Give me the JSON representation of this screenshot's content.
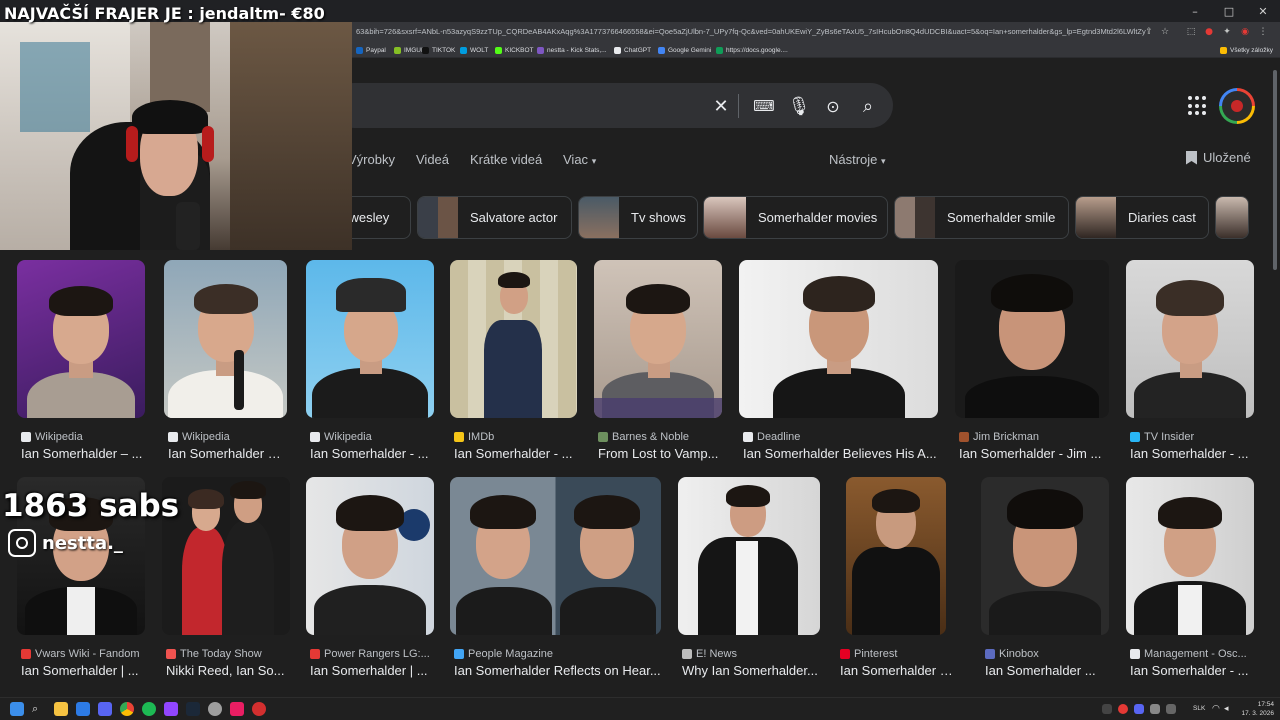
{
  "stream": {
    "title": "NAJVAČŠÍ FRAJER JE : jendaltm- €80",
    "subs": "1863 sabs",
    "instagram": "nestta._"
  },
  "browser": {
    "url": "63&bih=726&sxsrf=ANbL-n53azyqS9zzTUp_CQRDeAB4AKxAqg%3A1773766466558&ei=Qoe5aZjUlbn-7_UPy7fq-Qc&ved=0ahUKEwiY_ZyBs6eTAxU5_7sIHcubOn8Q4dUDCBI&uact=5&oq=Ian+somerhalder&gs_lp=Egtnd3Mtd2l6LWltZyIPSWFuIHNvbW",
    "all_bookmarks": "Všetky záložky",
    "bookmarks": [
      {
        "label": "Paypal",
        "color": "#1565c0"
      },
      {
        "label": "IMGUR",
        "color": "#85bf25"
      },
      {
        "label": "TIKTOK",
        "color": "#111111"
      },
      {
        "label": "WOLT",
        "color": "#009de0"
      },
      {
        "label": "KICKBOT",
        "color": "#53fc18"
      },
      {
        "label": "nestta - Kick Stats,...",
        "color": "#7e57c2"
      },
      {
        "label": "ChatGPT",
        "color": "#e8eaed"
      },
      {
        "label": "Google Gemini",
        "color": "#4285f4"
      },
      {
        "label": "https://docs.google....",
        "color": "#0f9d58"
      }
    ]
  },
  "nav": {
    "tabs": [
      "Výrobky",
      "Videá",
      "Krátke videá",
      "Viac"
    ],
    "tools": "Nástroje",
    "saved": "Uložené"
  },
  "chips": [
    "l wesley",
    "Salvatore actor",
    "Tv shows",
    "Somerhalder movies",
    "Somerhalder smile",
    "Diaries cast"
  ],
  "results_row1": [
    {
      "source": "Wikipedia",
      "title": "Ian Somerhalder – ...",
      "icon_color": "#e8eaed"
    },
    {
      "source": "Wikipedia",
      "title": "Ian Somerhalder – ...",
      "icon_color": "#e8eaed"
    },
    {
      "source": "Wikipedia",
      "title": "Ian Somerhalder - ...",
      "icon_color": "#e8eaed"
    },
    {
      "source": "IMDb",
      "title": "Ian Somerhalder - ...",
      "icon_color": "#f5c518"
    },
    {
      "source": "Barnes & Noble",
      "title": "From Lost to Vamp...",
      "icon_color": "#6d8f5e"
    },
    {
      "source": "Deadline",
      "title": "Ian Somerhalder Believes His A...",
      "icon_color": "#e8eaed"
    },
    {
      "source": "Jim Brickman",
      "title": "Ian Somerhalder - Jim ...",
      "icon_color": "#a0522d"
    },
    {
      "source": "TV Insider",
      "title": "Ian Somerhalder - ...",
      "icon_color": "#29b6f6"
    }
  ],
  "results_row2": [
    {
      "source": "Vwars Wiki - Fandom",
      "title": "Ian Somerhalder | ...",
      "icon_color": "#e53935"
    },
    {
      "source": "The Today Show",
      "title": "Nikki Reed, Ian So...",
      "icon_color": "#ef5350"
    },
    {
      "source": "Power Rangers LG:...",
      "title": "Ian Somerhalder | ...",
      "icon_color": "#e53935"
    },
    {
      "source": "People Magazine",
      "title": "Ian Somerhalder Reflects on Hear...",
      "icon_color": "#42a5f5"
    },
    {
      "source": "E! News",
      "title": "Why Ian Somerhalder...",
      "icon_color": "#bdbdbd"
    },
    {
      "source": "Pinterest",
      "title": "Ian Somerhalder | I...",
      "icon_color": "#e60023"
    },
    {
      "source": "Kinobox",
      "title": "Ian Somerhalder ...",
      "icon_color": "#5c6bc0"
    },
    {
      "source": "Management - Osc...",
      "title": "Ian Somerhalder - ...",
      "icon_color": "#e8eaed"
    }
  ],
  "tray": {
    "lang": "SLK",
    "time": "17:54",
    "date": "17. 3. 2026"
  }
}
